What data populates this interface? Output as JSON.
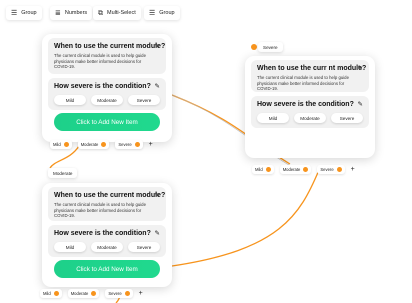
{
  "colors": {
    "accent_orange": "#f7941d",
    "button_green": "#1ed08a",
    "section_gray": "#f1f1f1"
  },
  "toolbar": {
    "items": [
      {
        "label": "Group",
        "icon": "list-icon"
      },
      {
        "label": "Numbers",
        "icon": "numbered-list-icon"
      },
      {
        "label": "Multi-Select",
        "icon": "multi-select-icon"
      },
      {
        "label": "Group",
        "icon": "list-icon"
      }
    ]
  },
  "module_question": "When to use the current module?",
  "module_question_alt": "When to use the curr nt module?",
  "module_desc": "The current clinical module is used to help guide physicians make better informed decisions for COVID-19.",
  "severity_question": "How severe is the condition?",
  "options": [
    "Mild",
    "Moderate",
    "Severe"
  ],
  "add_button": "Click to Add New Item",
  "pills": [
    "Mild",
    "Moderate",
    "Severe"
  ],
  "plus": "+",
  "tags": {
    "severe": "Severe",
    "moderate": "Moderate"
  }
}
